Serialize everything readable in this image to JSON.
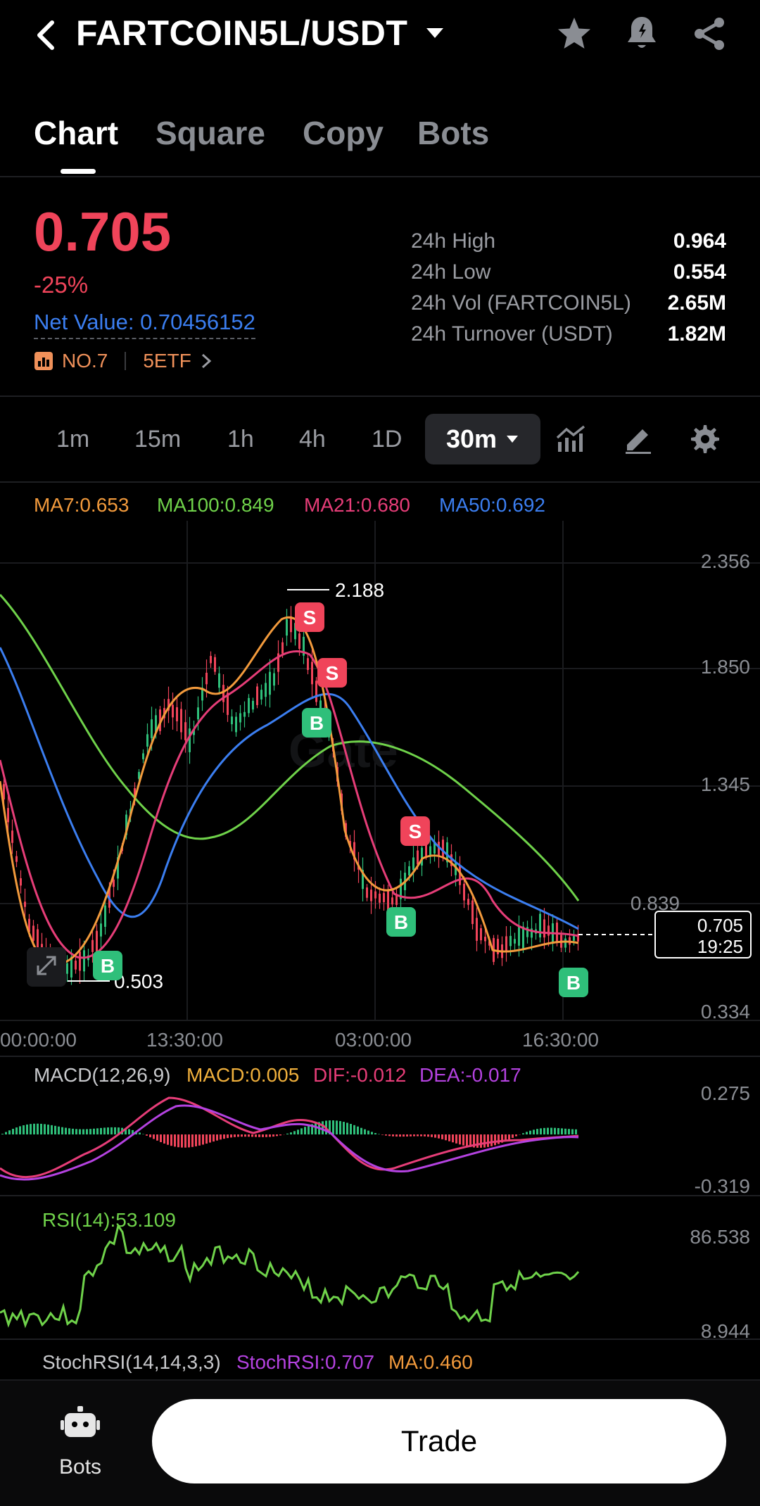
{
  "header": {
    "title": "FARTCOIN5L/USDT",
    "back_icon": "back-arrow-icon",
    "dropdown_icon": "caret-down-icon",
    "star_icon": "star-icon",
    "alert_icon": "bell-alert-icon",
    "share_icon": "share-icon"
  },
  "tabs": [
    {
      "label": "Chart"
    },
    {
      "label": "Square"
    },
    {
      "label": "Copy"
    },
    {
      "label": "Bots"
    }
  ],
  "ticker": {
    "price": "0.705",
    "change": "-25%",
    "net_value": "Net Value: 0.70456152",
    "rank": "NO.7",
    "etf": "5ETF",
    "stats": [
      {
        "label": "24h High",
        "value": "0.964"
      },
      {
        "label": "24h Low",
        "value": "0.554"
      },
      {
        "label": "24h Vol (FARTCOIN5L)",
        "value": "2.65M"
      },
      {
        "label": "24h Turnover (USDT)",
        "value": "1.82M"
      }
    ]
  },
  "timeframes": {
    "options": [
      "1m",
      "15m",
      "1h",
      "4h",
      "1D"
    ],
    "selected": "30m"
  },
  "ma_legend": {
    "ma7": "MA7:0.653",
    "ma100": "MA100:0.849",
    "ma21": "MA21:0.680",
    "ma50": "MA50:0.692"
  },
  "price_axis": [
    "2.356",
    "1.850",
    "1.345",
    "0.839",
    "0.334"
  ],
  "time_axis": [
    "00:00:00",
    "13:30:00",
    "03:00:00",
    "16:30:00"
  ],
  "annotations": {
    "high": "2.188",
    "low": "0.503",
    "current_price": "0.705",
    "countdown": "19:25",
    "sell": "S",
    "buy": "B"
  },
  "macd": {
    "label": "MACD(12,26,9)",
    "macd": "MACD:0.005",
    "dif": "DIF:-0.012",
    "dea": "DEA:-0.017",
    "axis_top": "0.275",
    "axis_bottom": "-0.319"
  },
  "rsi": {
    "label": "RSI(14):53.109",
    "axis_top": "86.538",
    "axis_bottom": "8.944"
  },
  "stochrsi": {
    "label": "StochRSI(14,14,3,3)",
    "value": "StochRSI:0.707",
    "ma": "MA:0.460"
  },
  "bottom": {
    "bots_label": "Bots",
    "trade_label": "Trade"
  },
  "colors": {
    "red": "#f0445a",
    "green": "#2fbf7a",
    "ma7": "#f29a3c",
    "ma100": "#6fd24a",
    "ma21": "#e63d78",
    "ma50": "#3b7ef0",
    "macd": "#f0b03c",
    "dea": "#b442e0"
  }
}
